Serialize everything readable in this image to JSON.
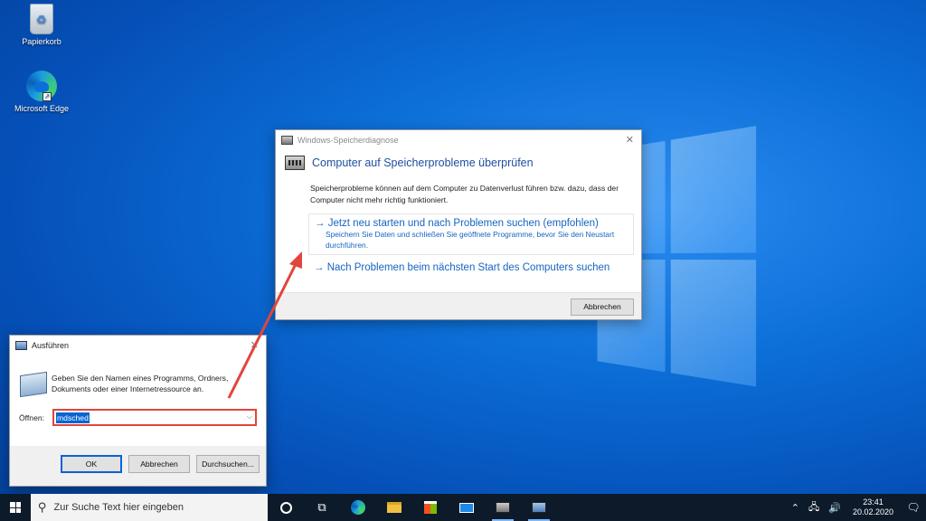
{
  "desktop": {
    "icons": [
      {
        "label": "Papierkorb",
        "icon": "recycle-bin-icon"
      },
      {
        "label": "Microsoft Edge",
        "icon": "edge-icon"
      }
    ]
  },
  "memory_diagnostic": {
    "title": "Windows-Speicherdiagnose",
    "close_glyph": "✕",
    "heading": "Computer auf Speicherprobleme überprüfen",
    "description": "Speicherprobleme können auf dem Computer zu Datenverlust führen bzw. dazu, dass der Computer nicht mehr richtig funktioniert.",
    "option1_title": "→ Jetzt neu starten und nach Problemen suchen (empfohlen)",
    "option1_desc": "Speichern Sie Daten und schließen Sie geöffnete Programme, bevor Sie den Neustart durchführen.",
    "option2_title": "→ Nach Problemen beim nächsten Start des Computers suchen",
    "cancel_label": "Abbrechen"
  },
  "run_dialog": {
    "title": "Ausführen",
    "close_glyph": "✕",
    "description": "Geben Sie den Namen eines Programms, Ordners, Dokuments oder einer Internetressource an.",
    "open_label": "Öffnen:",
    "open_value": "mdsched",
    "ok_label": "OK",
    "cancel_label": "Abbrechen",
    "browse_label": "Durchsuchen..."
  },
  "annotation": {
    "arrow_color": "#e2453c"
  },
  "taskbar": {
    "search_placeholder": "Zur Suche Text hier eingeben",
    "time": "23:41",
    "date": "20.02.2020",
    "tray_up": "⌃",
    "notification_glyph": "🗨"
  }
}
